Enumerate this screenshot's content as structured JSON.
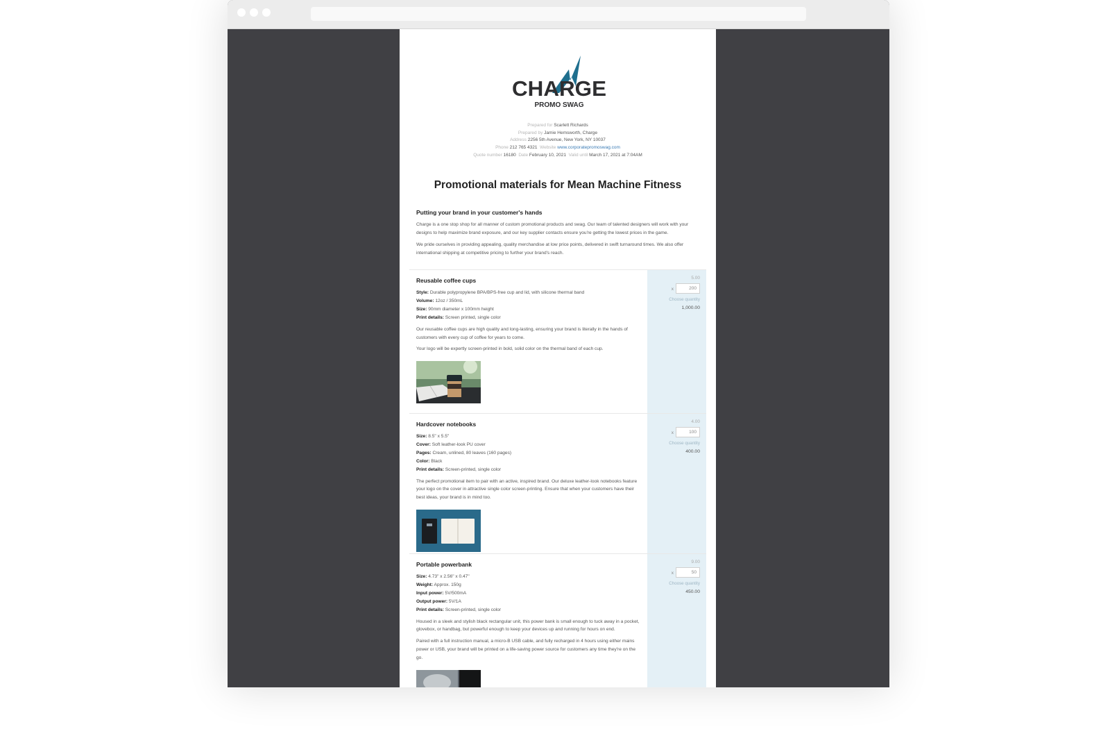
{
  "colors": {
    "accent": "#1f6f8e",
    "panel": "#e4f0f6",
    "backdrop": "#404044"
  },
  "logo": {
    "word": "CHARGE",
    "sub": "PROMO SWAG"
  },
  "meta": {
    "prepared_for_label": "Prepared for",
    "prepared_for": "Scarlett Richards",
    "prepared_by_label": "Prepared by",
    "prepared_by": "Jamie Hemsworth, Charge",
    "address_label": "Address",
    "address": "2256 5th Avenue, New York, NY 10037",
    "phone_label": "Phone",
    "phone": "212 765 4321",
    "website_label": "Website",
    "website": "www.corporatepromoswag.com",
    "quote_number_label": "Quote number",
    "quote_number": "16180",
    "date_label": "Date",
    "date": "February 10, 2021",
    "valid_label": "Valid until",
    "valid_until": "March 17, 2021 at 7:04AM"
  },
  "title": "Promotional materials for Mean Machine Fitness",
  "intro": {
    "heading": "Putting your brand in your customer's hands",
    "paragraphs": [
      "Charge is a one stop shop for all manner of custom promotional products and swag. Our team of talented designers will work with your designs to help maximize brand exposure, and our key supplier contacts ensure you're getting the lowest prices in the game.",
      "We pride ourselves in providing appealing, quality merchandise at low price points, delivered in swift turnaround times. We also offer international shipping at competitive pricing to further your brand's reach."
    ]
  },
  "items": [
    {
      "title": "Reusable coffee cups",
      "specs": [
        {
          "label": "Style:",
          "value": "Durable polypropylene BPA/BPS-free cup and lid, with silicone thermal band"
        },
        {
          "label": "Volume:",
          "value": "12oz / 350mL"
        },
        {
          "label": "Size:",
          "value": "90mm diameter x 100mm height"
        },
        {
          "label": "Print details:",
          "value": "Screen printed, single color"
        }
      ],
      "paragraphs": [
        "Our reusable coffee cups are high quality and long-lasting, ensuring your brand is literally in the hands of customers with every cup of coffee for years to come.",
        "Your logo will be expertly screen-printed in bold, solid color on the thermal band of each cup."
      ],
      "image": "coffee-cup-photo",
      "price": "5.00",
      "qty_prefix": "x",
      "quantity": "200",
      "choose_label": "Choose quantity",
      "total": "1,000.00"
    },
    {
      "title": "Hardcover notebooks",
      "specs": [
        {
          "label": "Size:",
          "value": "8.5\" x 5.5\""
        },
        {
          "label": "Cover:",
          "value": "Soft leather-look PU cover"
        },
        {
          "label": "Pages:",
          "value": "Cream, unlined, 80 leaves (160 pages)"
        },
        {
          "label": "Color:",
          "value": "Black"
        },
        {
          "label": "Print details:",
          "value": "Screen-printed, single color"
        }
      ],
      "paragraphs": [
        "The perfect promotional item to pair with an active, inspired brand. Our deluxe leather-look notebooks feature your logo on the cover in attractive single color screen-printing. Ensure that when your customers have their best ideas, your brand is in mind too."
      ],
      "image": "notebook-photo",
      "price": "4.00",
      "qty_prefix": "x",
      "quantity": "100",
      "choose_label": "Choose quantity",
      "total": "400.00"
    },
    {
      "title": "Portable powerbank",
      "specs": [
        {
          "label": "Size:",
          "value": "4.73\" x 2.56\" x 0.47\""
        },
        {
          "label": "Weight:",
          "value": "Approx. 150g"
        },
        {
          "label": "Input power:",
          "value": "5V/500mA"
        },
        {
          "label": "Output power:",
          "value": "5V/1A"
        },
        {
          "label": "Print details:",
          "value": "Screen-printed, single color"
        }
      ],
      "paragraphs": [
        "Housed in a sleek and stylish black rectangular unit, this power bank is small enough to tuck away in a pocket, glovebox, or handbag, but powerful enough to keep your devices up and running for hours on end.",
        "Paired with a full instruction manual, a micro-B USB cable, and fully recharged in 4 hours using either mains power or USB, your brand will be printed on a life-saving power source for customers any time they're on the go."
      ],
      "image": "powerbank-photo",
      "price": "9.00",
      "qty_prefix": "x",
      "quantity": "50",
      "choose_label": "Choose quantity",
      "total": "450.00"
    }
  ]
}
